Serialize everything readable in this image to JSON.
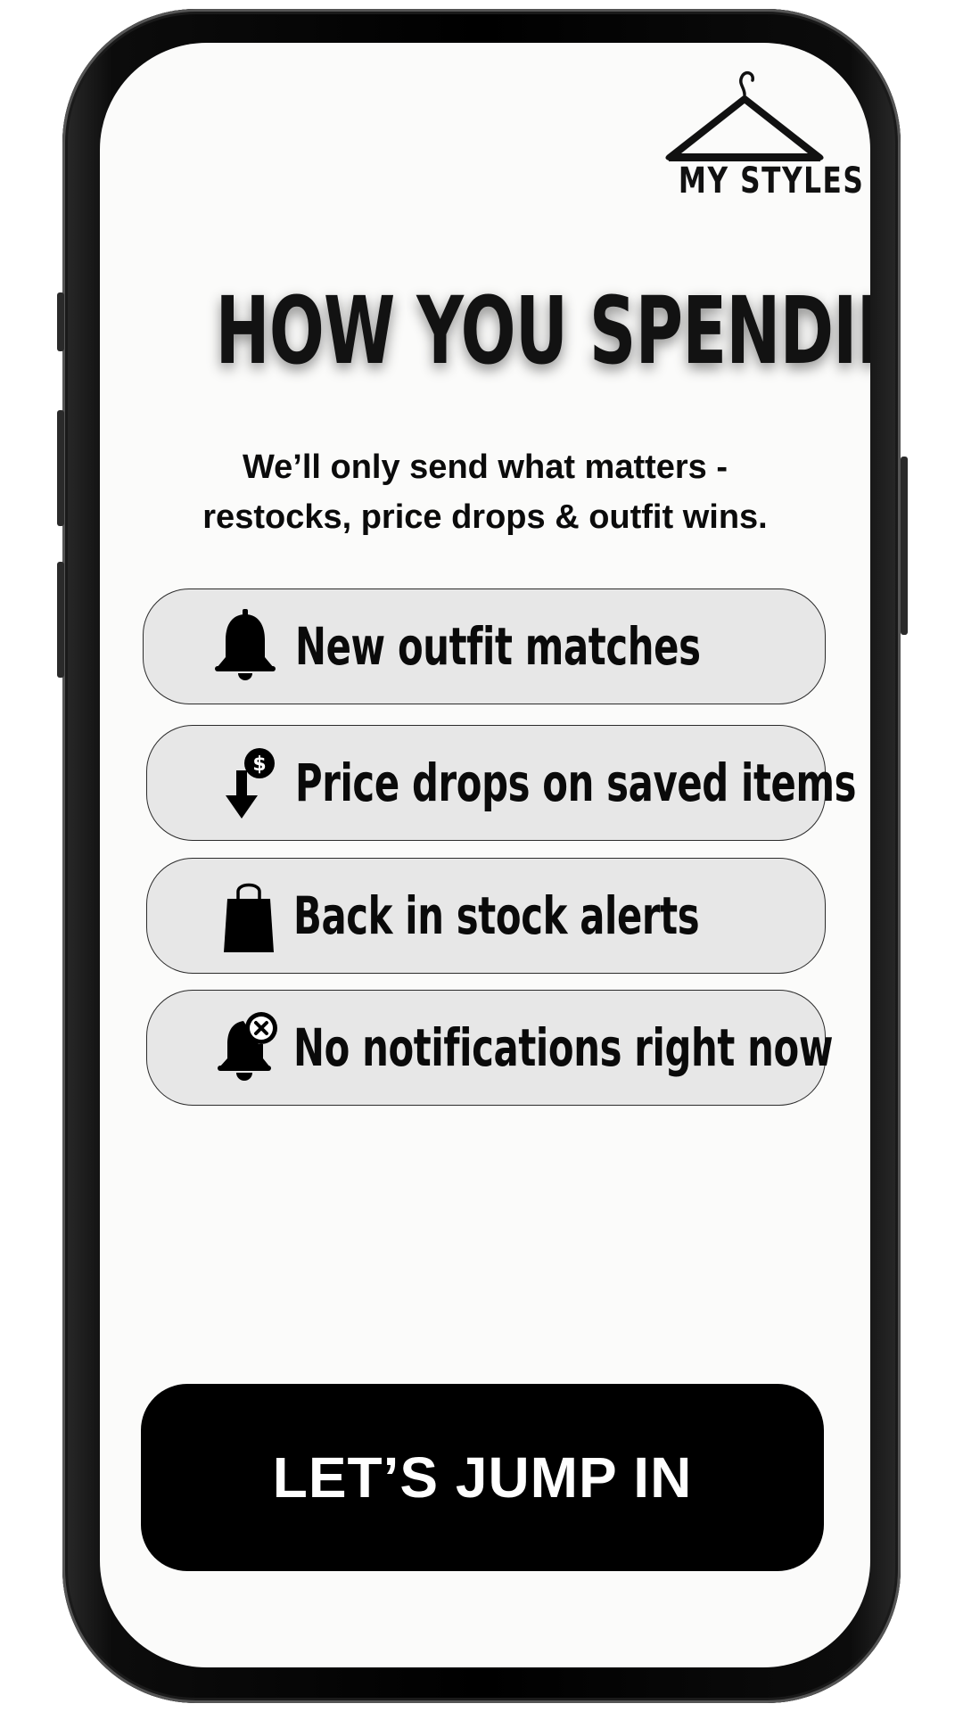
{
  "logo": {
    "text": "MY  STYLES",
    "icon": "hanger-icon"
  },
  "headline": "HOW YOU SPENDING?",
  "subtitle": {
    "line1": "We’ll only send what matters -",
    "line2": "restocks, price drops & outfit wins."
  },
  "options": [
    {
      "label": "New outfit matches",
      "icon": "bell-icon"
    },
    {
      "label": "Price drops on saved items",
      "icon": "price-drop-icon"
    },
    {
      "label": "Back in stock alerts",
      "icon": "shopping-bag-icon"
    },
    {
      "label": "No notifications right now",
      "icon": "bell-off-icon"
    }
  ],
  "cta": {
    "label": "LET’S JUMP IN"
  },
  "colors": {
    "screen_background": "#fbfbfa",
    "option_background": "#e7e7e7",
    "cta_background": "#000000",
    "cta_text": "#ffffff"
  }
}
